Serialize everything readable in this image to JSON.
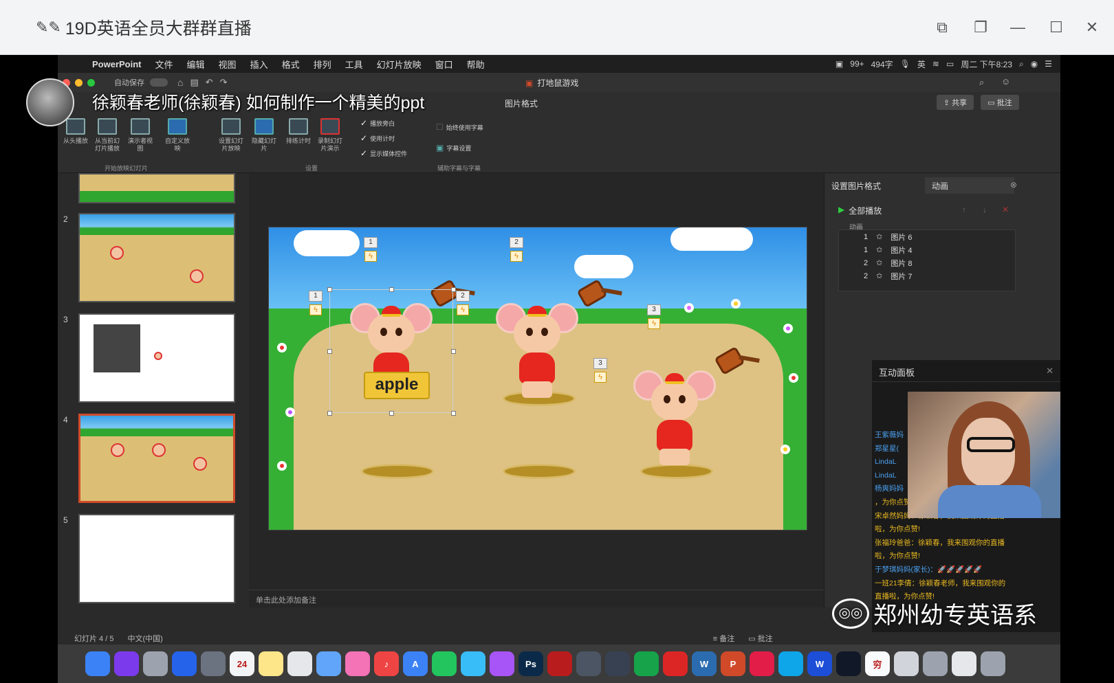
{
  "window": {
    "title": "19D英语全员大群群直播",
    "title_glyphs": "✎✎"
  },
  "overlay": {
    "caption": "徐颖春老师(徐颖春) 如何制作一个精美的ppt",
    "watermark": "郑州幼专英语系"
  },
  "mac_menu": {
    "app": "PowerPoint",
    "items": [
      "文件",
      "编辑",
      "视图",
      "插入",
      "格式",
      "排列",
      "工具",
      "幻灯片放映",
      "窗口",
      "帮助"
    ],
    "status": {
      "badge": "99+",
      "words": "494字",
      "lang": "英",
      "clock": "周二 下午8:23"
    }
  },
  "ppt": {
    "autosave": "自动保存",
    "doc_title": "打地鼠游戏",
    "tabs": {
      "picture_format": "图片格式"
    },
    "share": "共享",
    "comment": "批注",
    "ribbon": {
      "from_start": "从头播放",
      "from_current": "从当前幻灯片播放",
      "presenter": "演示者视图",
      "custom": "自定义放映",
      "setup": "设置幻灯片放映",
      "hide": "隐藏幻灯片",
      "rehearse": "排练计时",
      "record": "录制幻灯片演示",
      "play_narration": "播放旁白",
      "use_timings": "使用计时",
      "show_media": "显示媒体控件",
      "always_subtitles": "始终使用字幕",
      "subtitle_settings": "字幕设置",
      "group_start": "开始放映幻灯片",
      "group_setup": "设置",
      "group_captions": "辅助字幕与字幕"
    },
    "thumbnails": [
      {
        "num": "2"
      },
      {
        "num": "3"
      },
      {
        "num": "4"
      },
      {
        "num": "5"
      }
    ],
    "slide": {
      "word": "apple",
      "tags": [
        "1",
        "2",
        "1",
        "2",
        "3",
        "3"
      ]
    },
    "notes_placeholder": "单击此处添加备注",
    "panel": {
      "tab_format": "设置图片格式",
      "tab_animation": "动画",
      "play_all": "全部播放",
      "list_header": "动画",
      "animations": [
        {
          "order": "1",
          "name": "图片 6"
        },
        {
          "order": "1",
          "name": "图片 4"
        },
        {
          "order": "2",
          "name": "图片 8"
        },
        {
          "order": "2",
          "name": "图片 7"
        }
      ]
    },
    "status": {
      "slide_of": "幻灯片 4 / 5",
      "language": "中文(中国)",
      "notes": "备注",
      "comments": "批注"
    }
  },
  "chat": {
    "title": "互动面板",
    "messages": [
      {
        "name": "王紫薇妈",
        "text": ""
      },
      {
        "name": "郑星星(",
        "text": ""
      },
      {
        "name": "LindaL",
        "text": ""
      },
      {
        "name": "LindaL",
        "text": ""
      },
      {
        "name": "杨爽妈妈",
        "text": ""
      },
      {
        "name": "",
        "text": "，为你点赞!"
      },
      {
        "name": "",
        "text": "宋卓然妈妈：徐颖春，我来围观你的直播"
      },
      {
        "name": "",
        "text": "啦，为你点赞!"
      },
      {
        "name": "",
        "text": "张福玲爸爸：徐颖春，我来围观你的直播"
      },
      {
        "name": "",
        "text": "啦，为你点赞!"
      },
      {
        "name": "于梦琪妈妈(家长)：",
        "text": "🚀🚀🚀🚀🚀"
      },
      {
        "name": "",
        "text": "一班21李倩：徐颖春老师，我来围观你的"
      },
      {
        "name": "",
        "text": "直播啦，为你点赞!"
      }
    ]
  },
  "dock": {
    "apps": [
      {
        "label": "",
        "color": "#3b82f6"
      },
      {
        "label": "",
        "color": "#7c3aed"
      },
      {
        "label": "",
        "color": "#9ca3af"
      },
      {
        "label": "",
        "color": "#2563eb"
      },
      {
        "label": "",
        "color": "#6b7280"
      },
      {
        "label": "24",
        "color": "#f3f4f6"
      },
      {
        "label": "",
        "color": "#fde68a"
      },
      {
        "label": "",
        "color": "#e5e7eb"
      },
      {
        "label": "",
        "color": "#60a5fa"
      },
      {
        "label": "",
        "color": "#f472b6"
      },
      {
        "label": "♪",
        "color": "#ef4444"
      },
      {
        "label": "A",
        "color": "#3b82f6"
      },
      {
        "label": "",
        "color": "#22c55e"
      },
      {
        "label": "",
        "color": "#38bdf8"
      },
      {
        "label": "",
        "color": "#a855f7"
      },
      {
        "label": "Ps",
        "color": "#0b2a4a"
      },
      {
        "label": "",
        "color": "#b91c1c"
      },
      {
        "label": "",
        "color": "#4b5563"
      },
      {
        "label": "",
        "color": "#374151"
      },
      {
        "label": "",
        "color": "#16a34a"
      },
      {
        "label": "",
        "color": "#dc2626"
      },
      {
        "label": "W",
        "color": "#2b6cb0"
      },
      {
        "label": "P",
        "color": "#d04a2a"
      },
      {
        "label": "",
        "color": "#e11d48"
      },
      {
        "label": "",
        "color": "#0ea5e9"
      },
      {
        "label": "W",
        "color": "#1d4ed8"
      },
      {
        "label": "",
        "color": "#111827"
      },
      {
        "label": "穷",
        "color": "#f9fafb"
      },
      {
        "label": "",
        "color": "#d1d5db"
      },
      {
        "label": "",
        "color": "#9ca3af"
      },
      {
        "label": "",
        "color": "#e5e7eb"
      },
      {
        "label": "",
        "color": "#9ca3af"
      }
    ]
  }
}
